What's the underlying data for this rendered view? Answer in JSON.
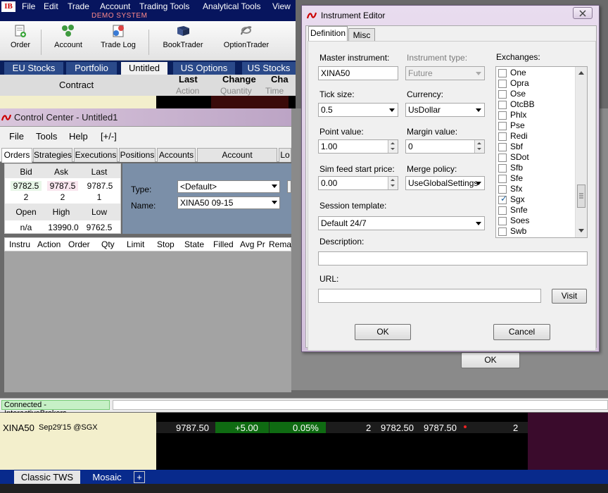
{
  "tws": {
    "logo": "IB",
    "menu": [
      "File",
      "Edit",
      "Trade",
      "Account",
      "Trading Tools",
      "Analytical Tools",
      "View"
    ],
    "demo_label": "DEMO SYSTEM",
    "toolbar": [
      {
        "label": "Order",
        "icon": "order-icon"
      },
      {
        "label": "Account",
        "icon": "account-icon"
      },
      {
        "label": "Trade Log",
        "icon": "trade-log-icon"
      },
      {
        "label": "BookTrader",
        "icon": "booktrader-icon"
      },
      {
        "label": "OptionTrader",
        "icon": "optiontrader-icon"
      }
    ],
    "page_tabs": [
      "EU Stocks",
      "Portfolio",
      "Untitled",
      "US Options",
      "US Stocks"
    ],
    "columns": {
      "contract": "Contract",
      "last": "Last",
      "change": "Change",
      "cha": "Cha",
      "action": "Action",
      "quantity": "Quantity",
      "time": "Time"
    }
  },
  "control_center": {
    "title": "Control Center - Untitled1",
    "menu": [
      "File",
      "Tools",
      "Help",
      "[+/-]"
    ],
    "tabs": [
      "Orders",
      "Strategies",
      "Executions",
      "Positions",
      "Accounts",
      "Account Performance",
      "Lo"
    ],
    "quote": {
      "headers_top": [
        "Bid",
        "Ask",
        "Last"
      ],
      "values_top": [
        "9782.5",
        "9787.5",
        "9787.5"
      ],
      "sizes": [
        "2",
        "2",
        "1"
      ],
      "headers_bottom": [
        "Open",
        "High",
        "Low"
      ],
      "values_bottom": [
        "n/a",
        "13990.0",
        "9762.5"
      ]
    },
    "type_label": "Type:",
    "type_value": "<Default>",
    "name_label": "Name:",
    "name_value": "XINA50 09-15",
    "order_columns": [
      "Instru",
      "Action",
      "Order",
      "Qty",
      "Limit",
      "Stop",
      "State",
      "Filled",
      "Avg Pr",
      "Remai"
    ],
    "connection_status": "Connected - InteractiveBrokers"
  },
  "ticker": {
    "symbol": "XINA50",
    "contract": "Sep29'15 @SGX",
    "last": "9787.50",
    "change": "+5.00",
    "change_pct": "0.05%",
    "bid_size": "2",
    "bid": "9782.50",
    "ask": "9787.50",
    "ask_size": "2"
  },
  "bottom_tabs": [
    "Classic TWS",
    "Mosaic",
    "+"
  ],
  "behind_ok": "OK",
  "dialog": {
    "title": "Instrument Editor",
    "tabs": [
      "Definition",
      "Misc"
    ],
    "master_instrument_label": "Master instrument:",
    "master_instrument_value": "XINA50",
    "instrument_type_label": "Instrument type:",
    "instrument_type_value": "Future",
    "exchanges_label": "Exchanges:",
    "tick_size_label": "Tick size:",
    "tick_size_value": "0.5",
    "currency_label": "Currency:",
    "currency_value": "UsDollar",
    "point_value_label": "Point value:",
    "point_value_value": "1.00",
    "margin_value_label": "Margin value:",
    "margin_value_value": "0",
    "sim_feed_label": "Sim feed start price:",
    "sim_feed_value": "0.00",
    "merge_policy_label": "Merge policy:",
    "merge_policy_value": "UseGlobalSettings",
    "session_template_label": "Session template:",
    "session_template_value": "Default 24/7",
    "description_label": "Description:",
    "description_value": "",
    "url_label": "URL:",
    "url_value": "",
    "visit_label": "Visit",
    "ok_label": "OK",
    "cancel_label": "Cancel",
    "exchanges": [
      {
        "name": "One",
        "checked": false
      },
      {
        "name": "Opra",
        "checked": false
      },
      {
        "name": "Ose",
        "checked": false
      },
      {
        "name": "OtcBB",
        "checked": false
      },
      {
        "name": "Phlx",
        "checked": false
      },
      {
        "name": "Pse",
        "checked": false
      },
      {
        "name": "Redi",
        "checked": false
      },
      {
        "name": "Sbf",
        "checked": false
      },
      {
        "name": "SDot",
        "checked": false
      },
      {
        "name": "Sfb",
        "checked": false
      },
      {
        "name": "Sfe",
        "checked": false
      },
      {
        "name": "Sfx",
        "checked": false
      },
      {
        "name": "Sgx",
        "checked": true
      },
      {
        "name": "Snfe",
        "checked": false
      },
      {
        "name": "Soes",
        "checked": false
      },
      {
        "name": "Swb",
        "checked": false
      }
    ]
  }
}
